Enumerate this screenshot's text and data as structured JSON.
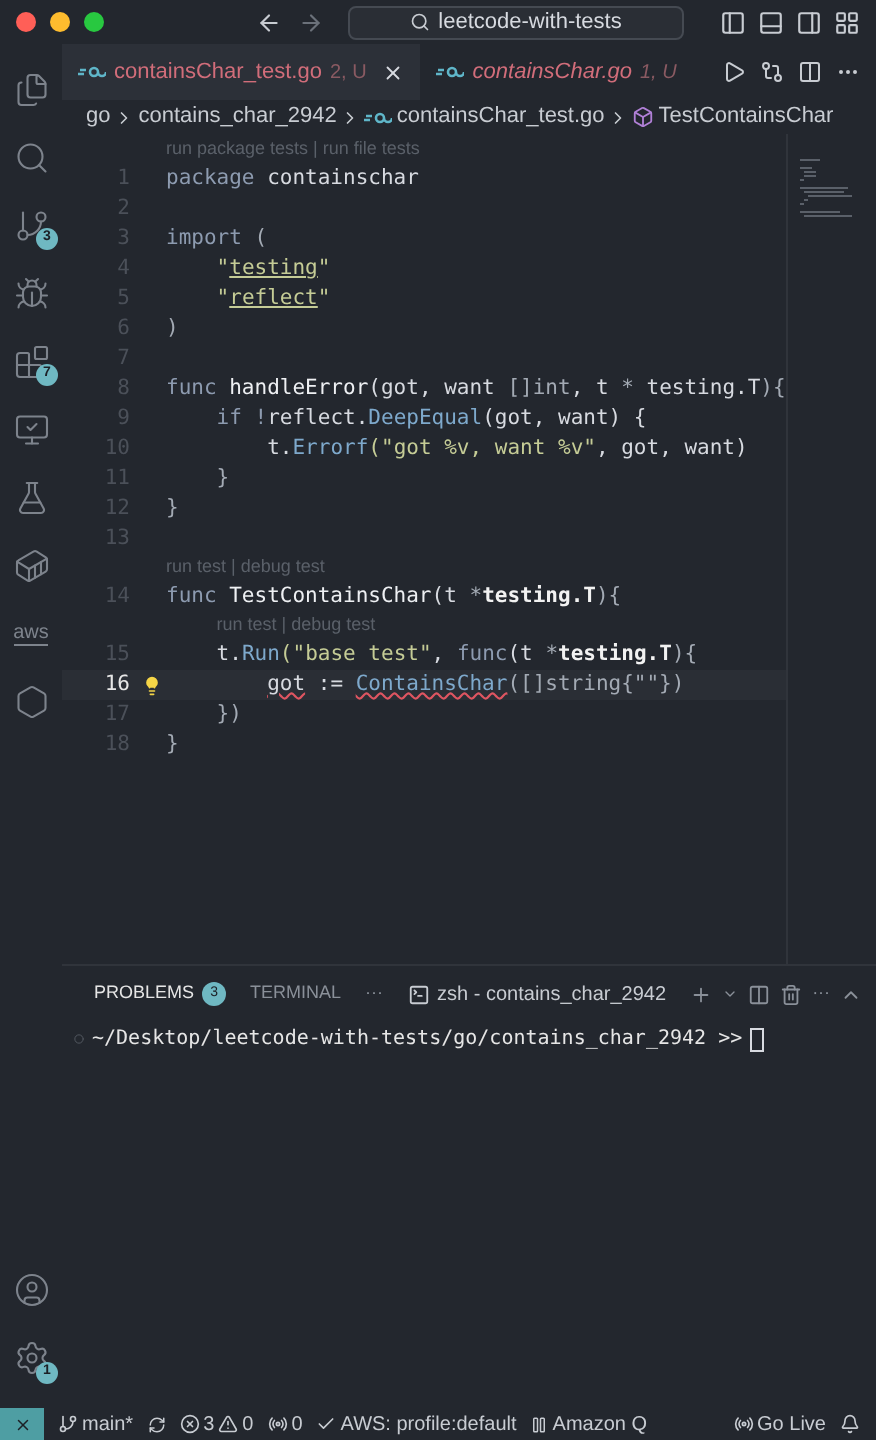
{
  "title_bar": {
    "search": "leetcode-with-tests"
  },
  "activity_bar": {
    "items": [
      {
        "kind": "files",
        "selected": false
      },
      {
        "kind": "search",
        "selected": false
      },
      {
        "kind": "scm",
        "badge": "3",
        "selected": false
      },
      {
        "kind": "debug",
        "selected": false
      },
      {
        "kind": "extensions",
        "badge": "7",
        "selected": false
      },
      {
        "kind": "remote",
        "selected": false
      },
      {
        "kind": "testing",
        "selected": false
      },
      {
        "kind": "docker",
        "selected": false
      },
      {
        "kind": "aws",
        "label": "aws",
        "selected": false
      },
      {
        "kind": "hex",
        "selected": false
      }
    ],
    "bottom": [
      {
        "kind": "account"
      },
      {
        "kind": "settings",
        "badge": "1"
      }
    ]
  },
  "tabs": [
    {
      "label": "containsChar_test.go",
      "status": "2, U",
      "selected": true,
      "preview": false
    },
    {
      "label": "containsChar.go",
      "status": "1, U",
      "selected": false,
      "preview": true
    }
  ],
  "breadcrumb": [
    {
      "kind": "folder",
      "label": "go"
    },
    {
      "kind": "folder",
      "label": "contains_char_2942"
    },
    {
      "kind": "file",
      "label": "containsChar_test.go"
    },
    {
      "kind": "symbol",
      "label": "TestContainsChar"
    }
  ],
  "editor": {
    "lines": [
      {
        "kind": "lens",
        "text": "run package tests | run file tests",
        "nested": false
      },
      {
        "kind": "code",
        "number": "1",
        "tokens": [
          {
            "text": "package ",
            "kind": "kw"
          },
          {
            "text": "containschar",
            "kind": "plain"
          }
        ]
      },
      {
        "kind": "code",
        "number": "2"
      },
      {
        "kind": "code",
        "number": "3",
        "tokens": [
          {
            "text": "import ",
            "kind": "kw"
          },
          {
            "text": "(",
            "kind": "punct"
          }
        ]
      },
      {
        "kind": "code",
        "number": "4",
        "tokens": [
          {
            "text": "    \"",
            "kind": "str"
          },
          {
            "text": "testing",
            "kind": "strlink"
          },
          {
            "text": "\"",
            "kind": "str"
          }
        ]
      },
      {
        "kind": "code",
        "number": "5",
        "tokens": [
          {
            "text": "    \"",
            "kind": "str"
          },
          {
            "text": "reflect",
            "kind": "strlink"
          },
          {
            "text": "\"",
            "kind": "str"
          }
        ]
      },
      {
        "kind": "code",
        "number": "6",
        "tokens": [
          {
            "text": ")",
            "kind": "punct"
          }
        ]
      },
      {
        "kind": "code",
        "number": "7"
      },
      {
        "kind": "code",
        "number": "8",
        "tokens": [
          {
            "text": "func ",
            "kind": "kw"
          },
          {
            "text": "handleError",
            "kind": "fn"
          },
          {
            "text": "(got, want ",
            "kind": "plain"
          },
          {
            "text": "[]int",
            "kind": "punct"
          },
          {
            "text": ", t ",
            "kind": "plain"
          },
          {
            "text": "* ",
            "kind": "punct"
          },
          {
            "text": "testing.T",
            "kind": "plain"
          },
          {
            "text": "){",
            "kind": "punct"
          }
        ]
      },
      {
        "kind": "code",
        "number": "9",
        "tokens": [
          {
            "text": "    if !",
            "kind": "kw"
          },
          {
            "text": "reflect.",
            "kind": "plain"
          },
          {
            "text": "DeepEqual",
            "kind": "call"
          },
          {
            "text": "(got, want) {",
            "kind": "plain"
          }
        ]
      },
      {
        "kind": "code",
        "number": "10",
        "tokens": [
          {
            "text": "        t.",
            "kind": "plain"
          },
          {
            "text": "Errorf",
            "kind": "call"
          },
          {
            "text": "(\"got %v, want %v\"",
            "kind": "str"
          },
          {
            "text": ", got, want)",
            "kind": "plain"
          }
        ]
      },
      {
        "kind": "code",
        "number": "11",
        "tokens": [
          {
            "text": "    }",
            "kind": "punct"
          }
        ]
      },
      {
        "kind": "code",
        "number": "12",
        "tokens": [
          {
            "text": "}",
            "kind": "punct"
          }
        ]
      },
      {
        "kind": "code",
        "number": "13"
      },
      {
        "kind": "lens",
        "text": "run test | debug test",
        "nested": false
      },
      {
        "kind": "code",
        "number": "14",
        "tokens": [
          {
            "text": "func ",
            "kind": "kw"
          },
          {
            "text": "TestContainsChar",
            "kind": "fn"
          },
          {
            "text": "(t ",
            "kind": "plain"
          },
          {
            "text": "*",
            "kind": "punct"
          },
          {
            "text": "testing.T",
            "kind": "bold"
          },
          {
            "text": "){",
            "kind": "punct"
          }
        ]
      },
      {
        "kind": "lens",
        "text": "run test | debug test",
        "nested": true
      },
      {
        "kind": "code",
        "number": "15",
        "tokens": [
          {
            "text": "    t.",
            "kind": "plain"
          },
          {
            "text": "Run",
            "kind": "call"
          },
          {
            "text": "(\"base test\"",
            "kind": "str"
          },
          {
            "text": ", ",
            "kind": "plain"
          },
          {
            "text": "func",
            "kind": "kw"
          },
          {
            "text": "(t ",
            "kind": "plain"
          },
          {
            "text": "*",
            "kind": "punct"
          },
          {
            "text": "testing.T",
            "kind": "bold"
          },
          {
            "text": "){",
            "kind": "punct"
          }
        ]
      },
      {
        "kind": "code",
        "number": "16",
        "current": true,
        "bulb": true,
        "tokens": [
          {
            "text": "        got",
            "kind": "err"
          },
          {
            "text": " := ",
            "kind": "plain"
          },
          {
            "text": "ContainsChar",
            "kind": "callerr"
          },
          {
            "text": "([]string{\"\"})",
            "kind": "punct"
          }
        ]
      },
      {
        "kind": "code",
        "number": "17",
        "tokens": [
          {
            "text": "    })",
            "kind": "punct"
          }
        ]
      },
      {
        "kind": "code",
        "number": "18",
        "tokens": [
          {
            "text": "}",
            "kind": "punct"
          }
        ]
      }
    ]
  },
  "panel": {
    "tabs": [
      {
        "label": "PROBLEMS",
        "badge": "3",
        "selected": true
      },
      {
        "label": "TERMINAL",
        "selected": false
      }
    ],
    "more": "···",
    "terminal_name": "zsh - contains_char_2942",
    "actions_more": "···",
    "prompt": "~/Desktop/leetcode-with-tests/go/contains_char_2942 >>"
  },
  "status_bar": {
    "branch": "main*",
    "errors": "3",
    "warnings": "0",
    "ports": "0",
    "aws": "AWS: profile:default",
    "amazon_q": "Amazon Q",
    "go_live": "Go Live"
  }
}
